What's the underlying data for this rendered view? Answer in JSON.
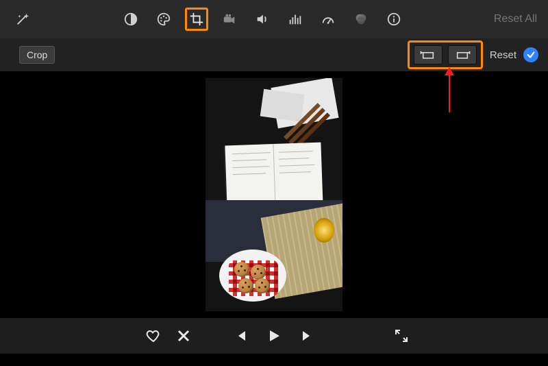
{
  "toolbar": {
    "reset_all_label": "Reset All",
    "icons": {
      "auto": "auto-enhance-icon",
      "balance": "color-balance-icon",
      "palette": "color-palette-icon",
      "crop": "crop-icon",
      "camera": "video-camera-icon",
      "audio": "volume-icon",
      "eq": "audio-equalizer-icon",
      "speed": "speedometer-icon",
      "filters": "color-filters-icon",
      "info": "info-icon"
    }
  },
  "crop_bar": {
    "mode_label": "Crop",
    "reset_label": "Reset"
  },
  "transport": {
    "favorite": "favorite",
    "reject": "reject",
    "prev": "previous",
    "play": "play",
    "next": "next",
    "fullscreen": "fullscreen"
  },
  "annotation": {
    "highlight_crop_tool": true,
    "highlight_rotate_buttons": true,
    "arrow_target": "rotate-buttons"
  }
}
